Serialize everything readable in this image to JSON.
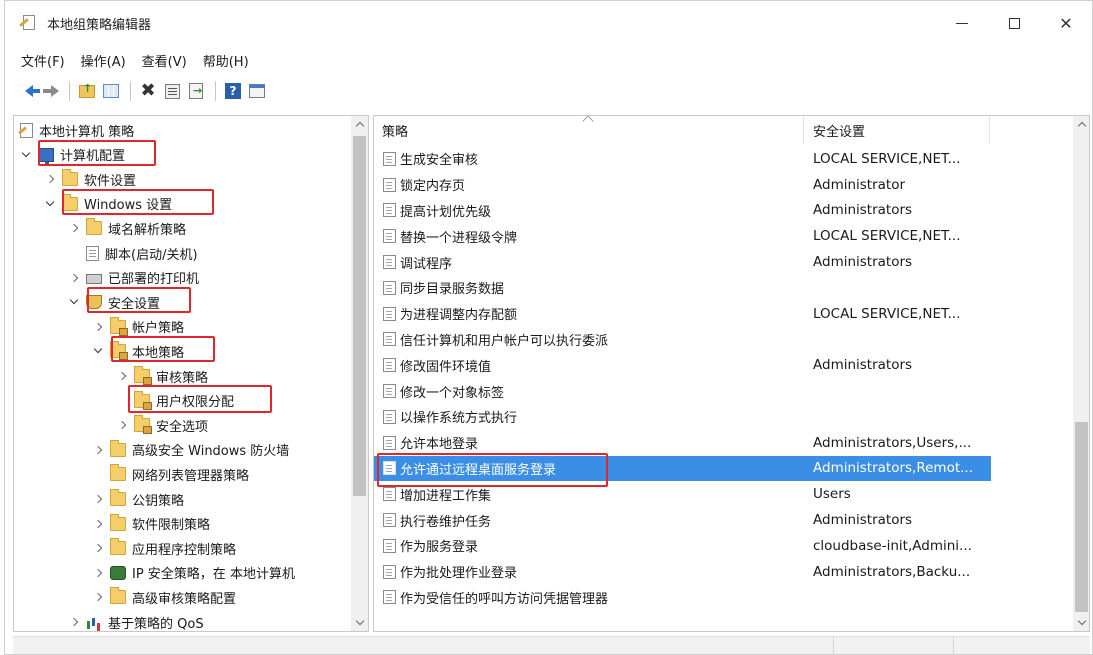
{
  "window": {
    "title": "本地组策略编辑器",
    "controls": {
      "minimize": "—",
      "maximize": "☐",
      "close": "✕"
    }
  },
  "menubar": {
    "items": [
      "文件(F)",
      "操作(A)",
      "查看(V)",
      "帮助(H)"
    ]
  },
  "toolbar": {
    "icons": [
      "back-icon",
      "forward-icon",
      "up-folder-icon",
      "show-hide-tree-icon",
      "delete-icon",
      "properties-icon",
      "export-list-icon",
      "help-icon",
      "view-icon"
    ]
  },
  "tree": {
    "items": [
      {
        "label": "本地计算机 策略",
        "icon": "policy-root",
        "level": 0,
        "expander": "none"
      },
      {
        "label": "计算机配置",
        "icon": "computer",
        "level": 0,
        "expander": "down",
        "highlighted": true
      },
      {
        "label": "软件设置",
        "icon": "folder",
        "level": 1,
        "expander": "right"
      },
      {
        "label": "Windows 设置",
        "icon": "folder",
        "level": 1,
        "expander": "down",
        "highlighted": true
      },
      {
        "label": "域名解析策略",
        "icon": "folder",
        "level": 2,
        "expander": "right"
      },
      {
        "label": "脚本(启动/关机)",
        "icon": "doc",
        "level": 2,
        "expander": "none"
      },
      {
        "label": "已部署的打印机",
        "icon": "printer",
        "level": 2,
        "expander": "right"
      },
      {
        "label": "安全设置",
        "icon": "shield",
        "level": 2,
        "expander": "down",
        "highlighted": true
      },
      {
        "label": "帐户策略",
        "icon": "folder-lock",
        "level": 3,
        "expander": "right"
      },
      {
        "label": "本地策略",
        "icon": "folder-lock",
        "level": 3,
        "expander": "down",
        "highlighted": true
      },
      {
        "label": "审核策略",
        "icon": "folder-lock",
        "level": 4,
        "expander": "right"
      },
      {
        "label": "用户权限分配",
        "icon": "folder-lock",
        "level": 4,
        "expander": "none",
        "highlighted": true
      },
      {
        "label": "安全选项",
        "icon": "folder-lock",
        "level": 4,
        "expander": "right"
      },
      {
        "label": "高级安全 Windows 防火墙",
        "icon": "folder",
        "level": 3,
        "expander": "right"
      },
      {
        "label": "网络列表管理器策略",
        "icon": "folder",
        "level": 3,
        "expander": "none"
      },
      {
        "label": "公钥策略",
        "icon": "folder",
        "level": 3,
        "expander": "right"
      },
      {
        "label": "软件限制策略",
        "icon": "folder",
        "level": 3,
        "expander": "right"
      },
      {
        "label": "应用程序控制策略",
        "icon": "folder",
        "level": 3,
        "expander": "right"
      },
      {
        "label": "IP 安全策略，在 本地计算机",
        "icon": "ipsec",
        "level": 3,
        "expander": "right"
      },
      {
        "label": "高级审核策略配置",
        "icon": "folder",
        "level": 3,
        "expander": "right"
      },
      {
        "label": "基于策略的 QoS",
        "icon": "chart",
        "level": 2,
        "expander": "right"
      }
    ]
  },
  "list": {
    "columns": [
      "策略",
      "安全设置"
    ],
    "rows": [
      {
        "policy": "生成安全审核",
        "setting": "LOCAL SERVICE,NET..."
      },
      {
        "policy": "锁定内存页",
        "setting": "Administrator"
      },
      {
        "policy": "提高计划优先级",
        "setting": "Administrators"
      },
      {
        "policy": "替换一个进程级令牌",
        "setting": "LOCAL SERVICE,NET..."
      },
      {
        "policy": "调试程序",
        "setting": "Administrators"
      },
      {
        "policy": "同步目录服务数据",
        "setting": ""
      },
      {
        "policy": "为进程调整内存配额",
        "setting": "LOCAL SERVICE,NET..."
      },
      {
        "policy": "信任计算机和用户帐户可以执行委派",
        "setting": ""
      },
      {
        "policy": "修改固件环境值",
        "setting": "Administrators"
      },
      {
        "policy": "修改一个对象标签",
        "setting": ""
      },
      {
        "policy": "以操作系统方式执行",
        "setting": ""
      },
      {
        "policy": "允许本地登录",
        "setting": "Administrators,Users,..."
      },
      {
        "policy": "允许通过远程桌面服务登录",
        "setting": "Administrators,Remot...",
        "selected": true
      },
      {
        "policy": "增加进程工作集",
        "setting": "Users"
      },
      {
        "policy": "执行卷维护任务",
        "setting": "Administrators"
      },
      {
        "policy": "作为服务登录",
        "setting": "cloudbase-init,Admini..."
      },
      {
        "policy": "作为批处理作业登录",
        "setting": "Administrators,Backu..."
      },
      {
        "policy": "作为受信任的呼叫方访问凭据管理器",
        "setting": ""
      }
    ]
  },
  "colors": {
    "selection": "#3a8ee6",
    "highlight_box": "#e0272e",
    "folder": "#f4cf69"
  }
}
